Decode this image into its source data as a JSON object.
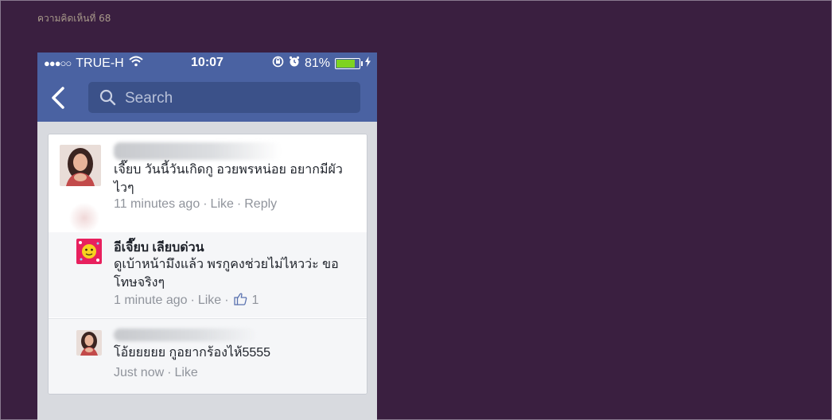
{
  "page": {
    "caption": "ความคิดเห็นที่ 68"
  },
  "status_bar": {
    "signal_dots": "●●●○○",
    "carrier": "TRUE-H",
    "time": "10:07",
    "battery_percent": "81%",
    "battery_level": 0.81
  },
  "header": {
    "back_icon": "chevron-left-icon",
    "search_placeholder": "Search"
  },
  "comments": [
    {
      "author": "",
      "text": "เจี๊ยบ วันนี้วันเกิดกู อวยพรหน่อย อยากมีผัวไวๆ",
      "time": "11 minutes ago",
      "actions": [
        "Like",
        "Reply"
      ]
    },
    {
      "author": "อีเจี๊ยบ เลียบด่วน",
      "text": "ดูเบ้าหน้ามึงแล้ว พรกูคงช่วยไม่ไหวว่ะ ขอโทษจริงๆ",
      "time": "1 minute ago",
      "actions": [
        "Like"
      ],
      "like_count": "1"
    },
    {
      "author": "",
      "text": "โอ้ยยยยย กูอยากร้องไห้5555",
      "time": "Just now",
      "actions": [
        "Like"
      ]
    }
  ],
  "colors": {
    "background": "#3a1f40",
    "header": "#4a62a2",
    "search_box": "#3b5189",
    "battery": "#7ed321"
  }
}
